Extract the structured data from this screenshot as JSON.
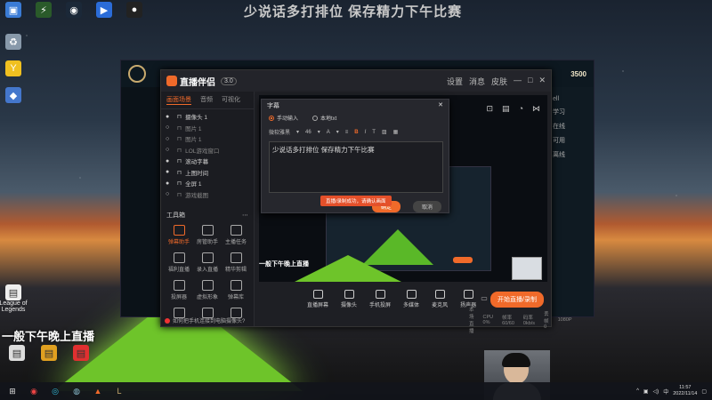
{
  "overlay_title": "少说话多打排位 保存精力下午比赛",
  "desktop": {
    "top_icons": [
      {
        "label": "",
        "icon": "computer-icon",
        "color": "#3a7bd5",
        "glyph": "▣"
      },
      {
        "label": "",
        "icon": "app-icon",
        "color": "#2a5a2a",
        "glyph": "⚡"
      },
      {
        "label": "",
        "icon": "steam-icon",
        "color": "#1b2838",
        "glyph": "◉"
      },
      {
        "label": "",
        "icon": "wegame-icon",
        "color": "#2b6cd8",
        "glyph": "▶"
      },
      {
        "label": "",
        "icon": "qq-icon",
        "color": "#222",
        "glyph": "●"
      }
    ],
    "left_icons": [
      {
        "label": "",
        "icon": "recycle-bin-icon",
        "color": "#8899aa",
        "glyph": "♻"
      },
      {
        "label": "",
        "icon": "yy-icon",
        "color": "#f0c020",
        "glyph": "Y"
      },
      {
        "label": "",
        "icon": "shortcut-icon",
        "color": "#4477cc",
        "glyph": "◆"
      }
    ],
    "bottom_icon": {
      "label": "League of Legends",
      "icon": "file-icon"
    },
    "overlay_text": "一般下午晚上直播",
    "bottom_row": [
      {
        "label": "",
        "icon": "file-icon",
        "color": "#ddd"
      },
      {
        "label": "",
        "icon": "game-icon",
        "color": "#e0a020"
      },
      {
        "label": "",
        "icon": "douyu-icon",
        "color": "#e03030"
      }
    ]
  },
  "game_client": {
    "coins": "3500",
    "right_panel_text": [
      "ell",
      "学习",
      "在线",
      "可用",
      "离线"
    ]
  },
  "app": {
    "brand": "直播伴侣",
    "version": "3.0",
    "header_controls": [
      "设置",
      "消息",
      "皮肤",
      "—",
      "□",
      "✕"
    ],
    "tabs": [
      {
        "label": "画面场景",
        "active": true
      },
      {
        "label": "音频",
        "active": false
      },
      {
        "label": "可视化",
        "active": false
      }
    ],
    "scenes": [
      {
        "label": "摄像头 1",
        "visible": true
      },
      {
        "label": "图片 1",
        "visible": false
      },
      {
        "label": "图片 1",
        "visible": false
      },
      {
        "label": "LOL游戏窗口",
        "visible": false
      },
      {
        "label": "滚动字幕",
        "visible": true
      },
      {
        "label": "上图时间",
        "visible": true
      },
      {
        "label": "全屏 1",
        "visible": true
      },
      {
        "label": "游戏截图",
        "visible": false
      }
    ],
    "tools_header": "工具箱",
    "tools": [
      {
        "label": "弹幕助手",
        "icon": "danmaku-icon",
        "hot": true
      },
      {
        "label": "房管助手",
        "icon": "manager-icon",
        "hot": false
      },
      {
        "label": "主播任务",
        "icon": "task-icon",
        "hot": false
      },
      {
        "label": "福利直播",
        "icon": "welfare-icon",
        "hot": false
      },
      {
        "label": "录入直播",
        "icon": "record-icon",
        "hot": false
      },
      {
        "label": "精华剪辑",
        "icon": "clip-icon",
        "hot": false
      },
      {
        "label": "投屏器",
        "icon": "cast-icon",
        "hot": false
      },
      {
        "label": "虚拟形象",
        "icon": "avatar-icon",
        "hot": false
      },
      {
        "label": "弹幕库",
        "icon": "library-icon",
        "hot": false
      },
      {
        "label": "",
        "icon": "more-icon",
        "hot": false
      },
      {
        "label": "",
        "icon": "gift-icon",
        "hot": false
      },
      {
        "label": "",
        "icon": "download-icon",
        "hot": false
      }
    ],
    "side_footer": "如何把手机连接到电脑摄像头?",
    "preview_overlay_text": "一般下午晚上直播",
    "bottom_toolbar": [
      {
        "label": "直播屏幕",
        "icon": "screen-icon"
      },
      {
        "label": "摄像头",
        "icon": "camera-icon"
      },
      {
        "label": "手机投屏",
        "icon": "phone-icon"
      },
      {
        "label": "多媒体",
        "icon": "media-icon"
      },
      {
        "label": "麦克风",
        "icon": "mic-icon"
      },
      {
        "label": "扬声器",
        "icon": "speaker-icon"
      }
    ],
    "start_button": "开始直播/录制",
    "status_items": [
      "本场直播",
      "CPU 0%",
      "帧率 60/60",
      "码率 0kb/s",
      "丢帧 0",
      "1080P"
    ]
  },
  "dialog": {
    "title": "字幕",
    "radio_manual": "手动输入",
    "radio_local": "本地txt",
    "font_select": "微软雅黑",
    "font_size": "46",
    "text_value": "少说话多打排位 保存精力下午比赛",
    "ok_label": "确定",
    "cancel_label": "取消",
    "toast": "直播/录制成功，请确认画面"
  },
  "taskbar": {
    "apps": [
      {
        "icon": "windows-icon",
        "glyph": "⊞",
        "color": "#ddd"
      },
      {
        "icon": "chrome-icon",
        "glyph": "◉",
        "color": "#e44"
      },
      {
        "icon": "edge-icon",
        "glyph": "◎",
        "color": "#3bd"
      },
      {
        "icon": "steam-icon",
        "glyph": "◍",
        "color": "#8bc"
      },
      {
        "icon": "stream-app-icon",
        "glyph": "▲",
        "color": "#f06a2a"
      },
      {
        "icon": "lol-icon",
        "glyph": "L",
        "color": "#c8aa6e"
      }
    ],
    "ime": "中",
    "time": "11:57",
    "date": "2022/11/14"
  }
}
